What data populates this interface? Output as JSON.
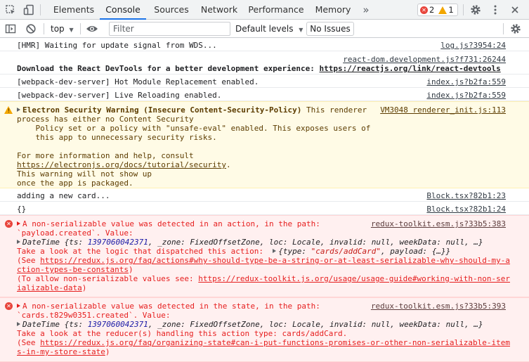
{
  "tabbar": {
    "tabs": [
      "Elements",
      "Console",
      "Sources",
      "Network",
      "Performance",
      "Memory"
    ],
    "more": "»",
    "error_count": "2",
    "warning_count": "1"
  },
  "toolbar": {
    "context": "top",
    "filter_placeholder": "Filter",
    "levels": "Default levels",
    "no_issues": "No Issues"
  },
  "messages": {
    "m1": {
      "text": "[HMR] Waiting for update signal from WDS...",
      "source": "log.js?3954:24"
    },
    "m2": {
      "source": "react-dom.development.js?f731:26244",
      "text": "Download the React DevTools for a better development experience: ",
      "link": "https://reactjs.org/link/react-devtools"
    },
    "m3": {
      "text": "[webpack-dev-server] Hot Module Replacement enabled.",
      "source": "index.js?b2fa:559"
    },
    "m4": {
      "text": "[webpack-dev-server] Live Reloading enabled.",
      "source": "index.js?b2fa:559"
    },
    "warn": {
      "title": "Electron Security Warning (Insecure Content-Security-Policy)",
      "title_rest": " This renderer",
      "source": "VM3048 renderer_init.js:113",
      "l2": "process has either no Content Security",
      "l3": "    Policy set or a policy with \"unsafe-eval\" enabled. This exposes users of",
      "l4": "    this app to unnecessary security risks.",
      "l5": "For more information and help, consult",
      "l6_link": "https://electronjs.org/docs/tutorial/security",
      "l6_end": ".",
      "l7": "This warning will not show up",
      "l8": "once the app is packaged."
    },
    "m5": {
      "text": "adding a new card...",
      "source": "Block.tsx?82b1:23"
    },
    "m6": {
      "text": "{}",
      "source": "Block.tsx?82b1:24"
    },
    "err1": {
      "l1": "A non-serializable value was detected in an action, in the path:",
      "source": "redux-toolkit.esm.js?33b5:383",
      "l2": "`payload.created`. Value:",
      "obj_name": "DateTime ",
      "obj_a": "{ts: ",
      "obj_num": "1397060042371",
      "obj_b": ", _zone: FixedOffsetZone, loc: Locale, invalid: null, weekData: null, …}",
      "l4": "Take a look at the logic that dispatched this action:  ",
      "l4_obj_a": "{type: ",
      "l4_obj_str": "\"cards/addCard\"",
      "l4_obj_b": ", payload: {…}}",
      "l5": "(See ",
      "l5_link": "https://redux.js.org/faq/actions#why-should-type-be-a-string-or-at-least-serializable-why-should-my-a",
      "l6_link": "ction-types-be-constants",
      "l6_end": ")",
      "l7": "(To allow non-serializable values see: ",
      "l7_link": "https://redux-toolkit.js.org/usage/usage-guide#working-with-non-ser",
      "l8_link": "ializable-data",
      "l8_end": ")"
    },
    "err2": {
      "l1": "A non-serializable value was detected in the state, in the path:",
      "source": "redux-toolkit.esm.js?33b5:393",
      "l2": "`cards.t829w0351.created`. Value:",
      "obj_name": "DateTime ",
      "obj_a": "{ts: ",
      "obj_num": "1397060042371",
      "obj_b": ", _zone: FixedOffsetZone, loc: Locale, invalid: null, weekData: null, …}",
      "l4": "Take a look at the reducer(s) handling this action type: cards/addCard.",
      "l5": "(See ",
      "l5_link": "https://redux.js.org/faq/organizing-state#can-i-put-functions-promises-or-other-non-serializable-item",
      "l6_link": "s-in-my-store-state",
      "l6_end": ")"
    }
  },
  "colors": {
    "accent": "#1a73e8",
    "error": "#e61e1e",
    "warning": "#f2a600"
  }
}
